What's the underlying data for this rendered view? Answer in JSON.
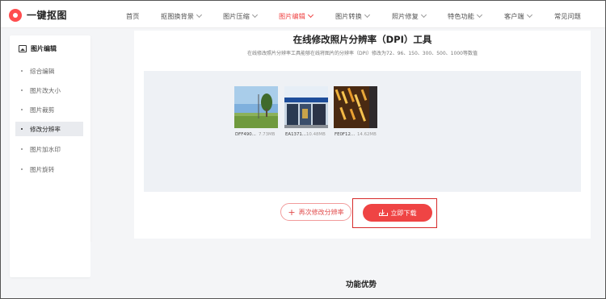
{
  "app": {
    "brand": "一键抠图"
  },
  "nav": {
    "items": [
      {
        "label": "首页",
        "dropdown": false,
        "active": false
      },
      {
        "label": "抠图换背景",
        "dropdown": true,
        "active": false
      },
      {
        "label": "图片压缩",
        "dropdown": true,
        "active": false
      },
      {
        "label": "图片编辑",
        "dropdown": true,
        "active": true
      },
      {
        "label": "图片转换",
        "dropdown": true,
        "active": false
      },
      {
        "label": "照片修复",
        "dropdown": true,
        "active": false
      },
      {
        "label": "特色功能",
        "dropdown": true,
        "active": false
      },
      {
        "label": "客户端",
        "dropdown": true,
        "active": false
      },
      {
        "label": "常见问题",
        "dropdown": false,
        "active": false
      }
    ]
  },
  "sidebar": {
    "heading": "图片编辑",
    "items": [
      {
        "label": "综合编辑",
        "active": false
      },
      {
        "label": "图片改大小",
        "active": false
      },
      {
        "label": "图片裁剪",
        "active": false
      },
      {
        "label": "修改分辨率",
        "active": true
      },
      {
        "label": "图片加水印",
        "active": false
      },
      {
        "label": "图片旋转",
        "active": false
      }
    ]
  },
  "main": {
    "title": "在线修改照片分辨率（DPI）工具",
    "subtitle": "在线修改照片分辨率工具能够在线将图片的分辨率（DPI）修改为72、96、150、300、500、1000等数值",
    "files": [
      {
        "name": "DFF490...",
        "size": "7.73MB",
        "icon": "landscape-thumbnail"
      },
      {
        "name": "EA1371...",
        "size": "10.48MB",
        "icon": "storefront-thumbnail"
      },
      {
        "name": "FE0F12...",
        "size": "14.62MB",
        "icon": "lights-thumbnail"
      }
    ],
    "redo_label": "再次修改分辨率",
    "download_label": "立即下载"
  },
  "features": {
    "title": "功能优势"
  },
  "colors": {
    "accent": "#ef4444",
    "background": "#f4f5f7"
  }
}
